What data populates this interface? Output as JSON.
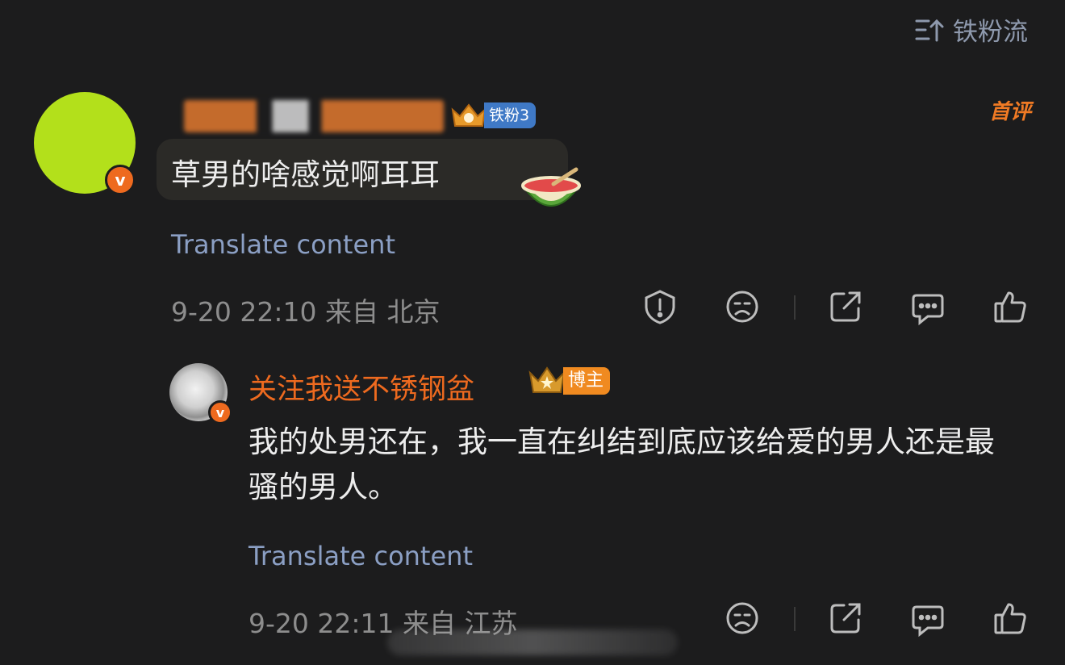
{
  "sort": {
    "label": "铁粉流",
    "icon": "sort-icon"
  },
  "comment": {
    "fan_badge": "铁粉3",
    "first_tag": "首评",
    "text": "草男的啥感觉啊耳耳",
    "emoji": "watermelon-icon",
    "translate": "Translate content",
    "meta": "9-20 22:10  来自 北京",
    "actions": [
      "report-icon",
      "dislike-icon",
      "share-icon",
      "comment-icon",
      "like-icon"
    ]
  },
  "reply": {
    "username": "关注我送不锈钢盆",
    "badge": "博主",
    "text": "我的处男还在，我一直在纠结到底应该给爱的男人还是最骚的男人。",
    "translate": "Translate content",
    "meta": "9-20 22:11  来自 江苏",
    "actions": [
      "dislike-icon",
      "share-icon",
      "comment-icon",
      "like-icon"
    ]
  },
  "verified_mark": "v",
  "colors": {
    "accent": "#ee6a1f",
    "link": "#8b9fc4",
    "fan_blue": "#3f79c6",
    "bg": "#1c1c1d"
  }
}
